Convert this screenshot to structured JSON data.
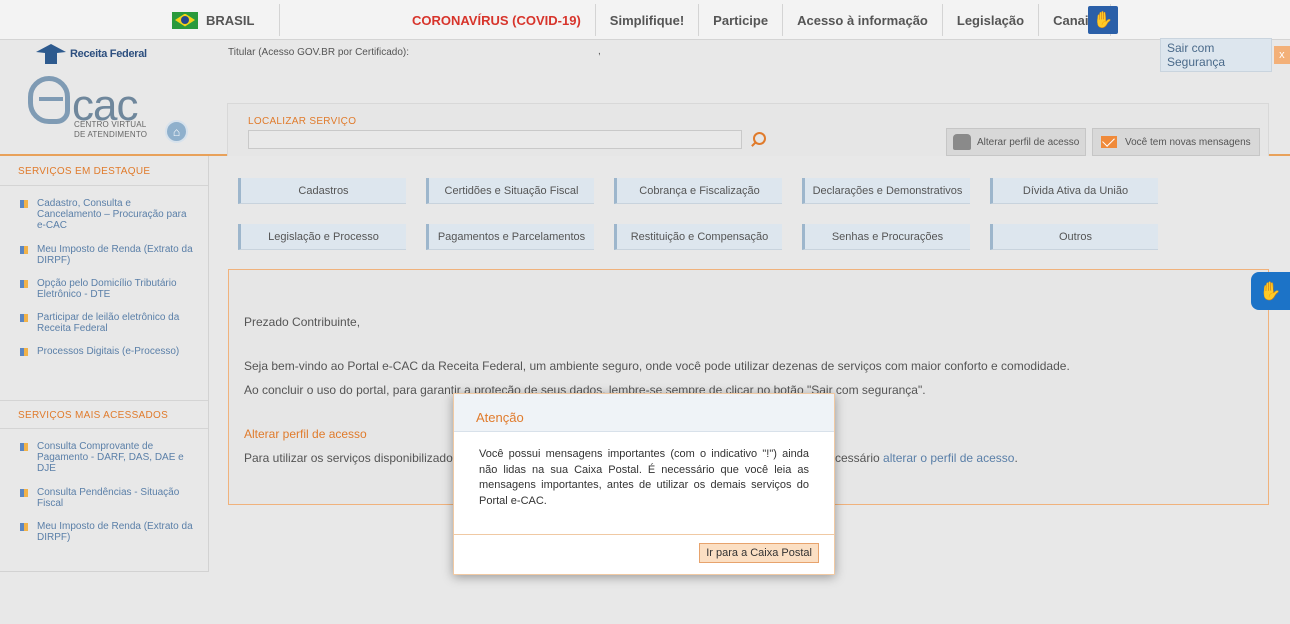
{
  "govbar": {
    "country": "BRASIL",
    "nav": [
      "CORONAVÍRUS (COVID-19)",
      "Simplifique!",
      "Participe",
      "Acesso à informação",
      "Legislação",
      "Canais"
    ],
    "accent_color": "#d7342b"
  },
  "header": {
    "logo_text": "Receita Federal",
    "titular": "Titular (Acesso GOV.BR por Certificado):",
    "titular_value": ",",
    "sair": "Sair com Segurança",
    "sair_close": "x",
    "ecac_word": "cac",
    "ecac_sub_1": "CENTRO VIRTUAL",
    "ecac_sub_2": "DE ATENDIMENTO",
    "search": {
      "label": "LOCALIZAR SERVIÇO",
      "value": "",
      "placeholder": ""
    },
    "perfil_button": "Alterar perfil de acesso",
    "messages_button": "Você tem novas mensagens"
  },
  "sidebar": {
    "destaque_title": "SERVIÇOS EM DESTAQUE",
    "destaque": [
      "Cadastro, Consulta e Cancelamento – Procuração para e-CAC",
      "Meu Imposto de Renda (Extrato da DIRPF)",
      "Opção pelo Domicílio Tributário Eletrônico - DTE",
      "Participar de leilão eletrônico da Receita Federal",
      "Processos Digitais (e-Processo)"
    ],
    "acessados_title": "SERVIÇOS MAIS ACESSADOS",
    "acessados": [
      "Consulta Comprovante de Pagamento - DARF, DAS, DAE e DJE",
      "Consulta Pendências - Situação Fiscal",
      "Meu Imposto de Renda (Extrato da DIRPF)"
    ]
  },
  "tabs": [
    "Cadastros",
    "Certidões e Situação Fiscal",
    "Cobrança e Fiscalização",
    "Declarações e Demonstrativos",
    "Dívida Ativa da União",
    "Legislação e Processo",
    "Pagamentos e Parcelamentos",
    "Restituição e Compensação",
    "Senhas e Procurações",
    "Outros"
  ],
  "content": {
    "greeting": "Prezado Contribuinte,",
    "welcome": "Seja bem-vindo ao Portal e-CAC da Receita Federal, um ambiente seguro, onde você pode utilizar dezenas de serviços com maior conforto e comodidade.",
    "reminder": "Ao concluir o uso do portal, para garantir a proteção de seus dados, lembre-se sempre de clicar no botão \"Sair com segurança\".",
    "alt_title": "Alterar perfil de acesso",
    "alt_text_start": "Para utilizar os serviços disponibilizado",
    "alt_text_end": "cessário",
    "alt_link": "alterar o perfil de acesso",
    "alt_period": "."
  },
  "dialog": {
    "title": "Atenção",
    "body": "Você possui mensagens importantes (com o indicativo \"!\") ainda não lidas na sua Caixa Postal. É necessário que você leia as mensagens importantes, antes de utilizar os demais serviços do Portal e-CAC.",
    "button": "Ir para a Caixa Postal"
  }
}
